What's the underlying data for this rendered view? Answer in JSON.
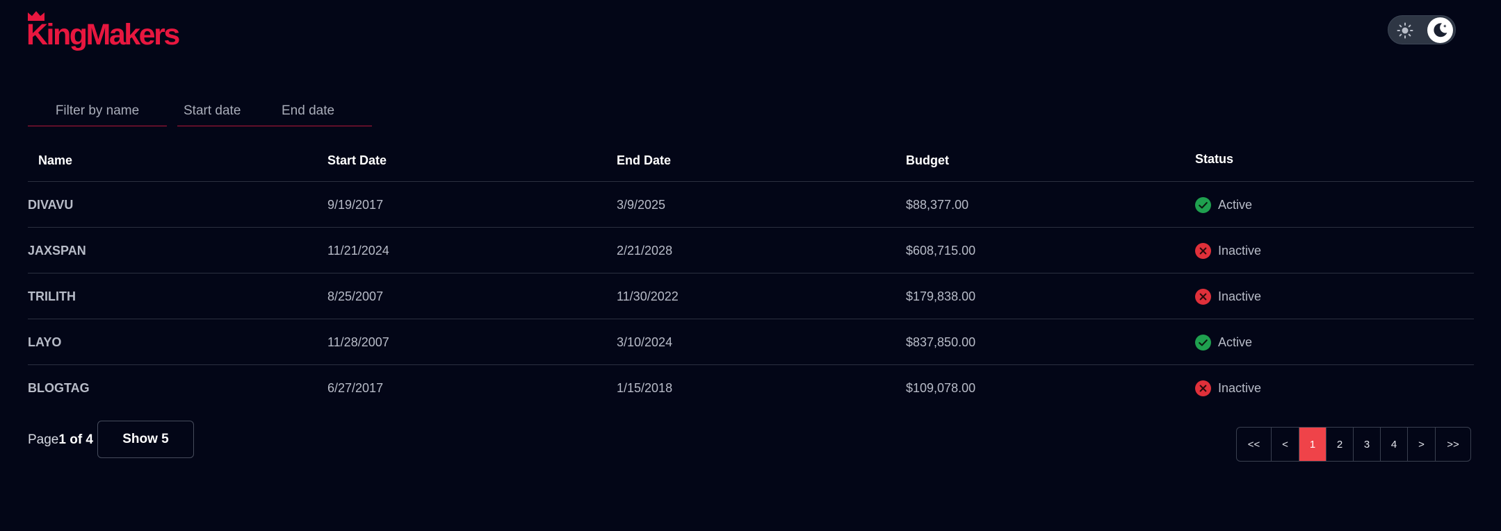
{
  "brand": {
    "name": "KingMakers",
    "color": "#e8173f"
  },
  "theme_toggle": {
    "mode": "dark",
    "light_icon": "sun-icon",
    "dark_icon": "moon-icon"
  },
  "filters": {
    "name_placeholder": "Filter by name",
    "start_placeholder": "Start date",
    "end_placeholder": "End date"
  },
  "table": {
    "headers": [
      "Name",
      "Start Date",
      "End Date",
      "Budget",
      "Status"
    ],
    "rows": [
      {
        "name": "DIVAVU",
        "start": "9/19/2017",
        "end": "3/9/2025",
        "budget": "$88,377.00",
        "status": "Active"
      },
      {
        "name": "JAXSPAN",
        "start": "11/21/2024",
        "end": "2/21/2028",
        "budget": "$608,715.00",
        "status": "Inactive"
      },
      {
        "name": "TRILITH",
        "start": "8/25/2007",
        "end": "11/30/2022",
        "budget": "$179,838.00",
        "status": "Inactive"
      },
      {
        "name": "LAYO",
        "start": "11/28/2007",
        "end": "3/10/2024",
        "budget": "$837,850.00",
        "status": "Active"
      },
      {
        "name": "BLOGTAG",
        "start": "6/27/2017",
        "end": "1/15/2018",
        "budget": "$109,078.00",
        "status": "Inactive"
      }
    ],
    "status_colors": {
      "Active": "#1fa04f",
      "Inactive": "#e0303a"
    }
  },
  "footer": {
    "page_prefix": "Page",
    "page_value": "1 of 4",
    "show_label": "Show 5"
  },
  "pagination": {
    "first": "<<",
    "prev": "<",
    "pages": [
      "1",
      "2",
      "3",
      "4"
    ],
    "current": "1",
    "next": ">",
    "last": ">>",
    "active_color": "#ef4349"
  }
}
